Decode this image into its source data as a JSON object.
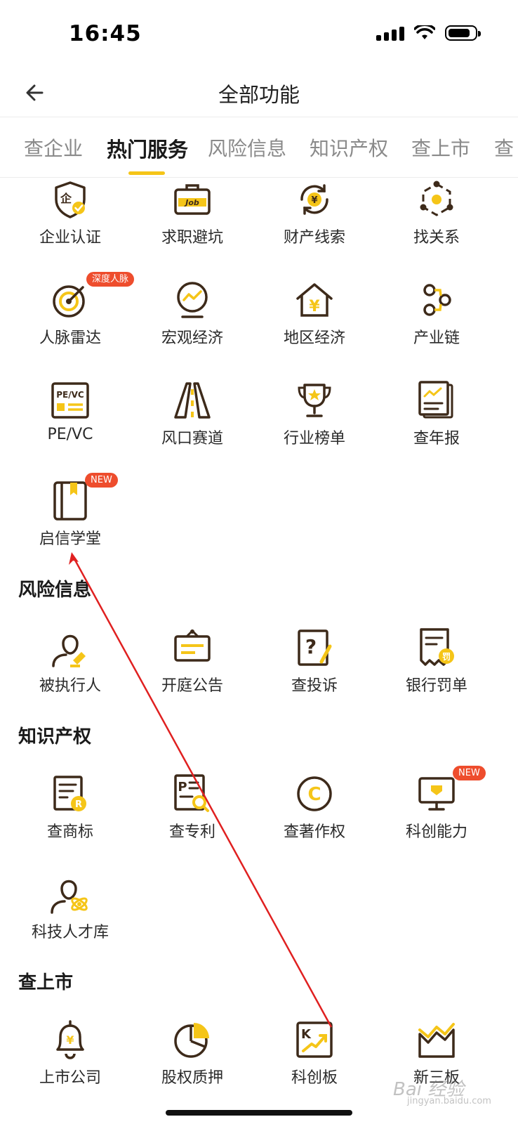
{
  "status": {
    "time": "16:45"
  },
  "nav": {
    "title": "全部功能"
  },
  "tabs": [
    {
      "label": "查企业"
    },
    {
      "label": "热门服务"
    },
    {
      "label": "风险信息"
    },
    {
      "label": "知识产权"
    },
    {
      "label": "查上市"
    },
    {
      "label": "查"
    }
  ],
  "active_tab": "热门服务",
  "hot": {
    "items": [
      {
        "label": "企业认证",
        "icon": "enterprise-shield-icon"
      },
      {
        "label": "求职避坑",
        "icon": "job-briefcase-icon"
      },
      {
        "label": "财产线索",
        "icon": "property-cycle-icon"
      },
      {
        "label": "找关系",
        "icon": "network-hex-icon"
      },
      {
        "label": "人脉雷达",
        "icon": "radar-icon",
        "badge": "深度人脉"
      },
      {
        "label": "宏观经济",
        "icon": "macro-chart-icon"
      },
      {
        "label": "地区经济",
        "icon": "region-house-icon"
      },
      {
        "label": "产业链",
        "icon": "chain-nodes-icon"
      },
      {
        "label": "PE/VC",
        "icon": "pevc-card-icon",
        "icon_text": "PE/VC"
      },
      {
        "label": "风口赛道",
        "icon": "road-track-icon"
      },
      {
        "label": "行业榜单",
        "icon": "trophy-icon"
      },
      {
        "label": "查年报",
        "icon": "annual-report-icon"
      },
      {
        "label": "启信学堂",
        "icon": "book-icon",
        "badge": "NEW"
      }
    ]
  },
  "risk": {
    "title": "风险信息",
    "items": [
      {
        "label": "被执行人",
        "icon": "executed-person-icon"
      },
      {
        "label": "开庭公告",
        "icon": "court-notice-icon"
      },
      {
        "label": "查投诉",
        "icon": "complaint-icon"
      },
      {
        "label": "银行罚单",
        "icon": "bank-fine-icon",
        "icon_text": "罚"
      }
    ]
  },
  "ip": {
    "title": "知识产权",
    "items": [
      {
        "label": "查商标",
        "icon": "trademark-icon"
      },
      {
        "label": "查专利",
        "icon": "patent-icon"
      },
      {
        "label": "查著作权",
        "icon": "copyright-icon"
      },
      {
        "label": "科创能力",
        "icon": "innovation-monitor-icon",
        "badge": "NEW"
      },
      {
        "label": "科技人才库",
        "icon": "talent-atom-icon"
      }
    ]
  },
  "listing": {
    "title": "查上市",
    "items": [
      {
        "label": "上市公司",
        "icon": "listed-bell-icon"
      },
      {
        "label": "股权质押",
        "icon": "equity-pie-icon"
      },
      {
        "label": "科创板",
        "icon": "star-market-icon"
      },
      {
        "label": "新三板",
        "icon": "new-third-board-icon"
      }
    ]
  },
  "icon_glyphs": {
    "enterprise": "企",
    "job": "Job",
    "yuan": "¥",
    "trademark": "R",
    "copyright": "C",
    "star_market": "K"
  },
  "watermark": {
    "text": "Bai 经验",
    "sub": "jingyan.baidu.com"
  },
  "colors": {
    "accent": "#f5c518",
    "icon_stroke": "#3d2a1a",
    "badge": "#ee4d2d"
  }
}
